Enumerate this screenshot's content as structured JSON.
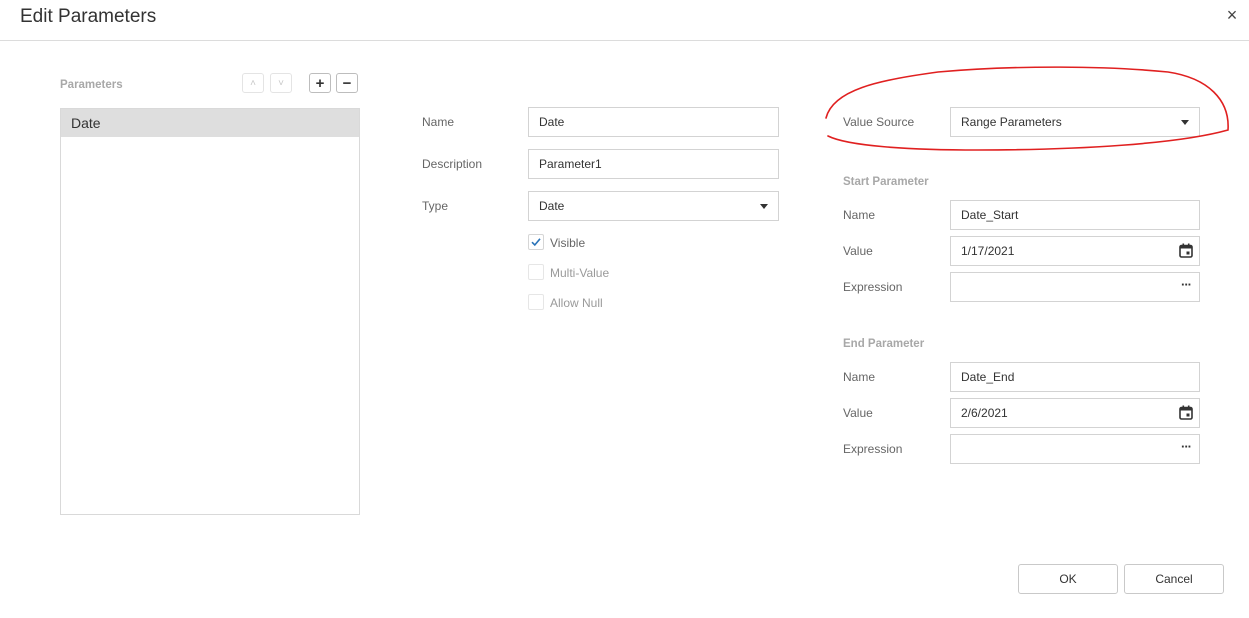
{
  "dialog": {
    "title": "Edit Parameters",
    "close_glyph": "×"
  },
  "parameters_panel": {
    "label": "Parameters",
    "move_up_glyph": "˄",
    "move_down_glyph": "˅",
    "add_glyph": "+",
    "remove_glyph": "−",
    "items": [
      {
        "label": "Date",
        "selected": true
      }
    ]
  },
  "general": {
    "name_label": "Name",
    "name_value": "Date",
    "description_label": "Description",
    "description_value": "Parameter1",
    "type_label": "Type",
    "type_value": "Date",
    "visible_label": "Visible",
    "visible_checked": true,
    "multi_value_label": "Multi-Value",
    "multi_value_checked": false,
    "allow_null_label": "Allow Null",
    "allow_null_checked": false
  },
  "value_source": {
    "label": "Value Source",
    "value": "Range Parameters",
    "annotation_color": "#e02020"
  },
  "start_parameter": {
    "section_label": "Start Parameter",
    "name_label": "Name",
    "name_value": "Date_Start",
    "value_label": "Value",
    "value_value": "1/17/2021",
    "expression_label": "Expression",
    "expression_value": "",
    "expression_button": "···"
  },
  "end_parameter": {
    "section_label": "End Parameter",
    "name_label": "Name",
    "name_value": "Date_End",
    "value_label": "Value",
    "value_value": "2/6/2021",
    "expression_label": "Expression",
    "expression_value": "",
    "expression_button": "···"
  },
  "footer": {
    "ok_label": "OK",
    "cancel_label": "Cancel"
  },
  "colors": {
    "accent": "#2a73b8",
    "selected_row": "#dedede",
    "border": "#d3d3d3"
  },
  "icons": [
    "close-icon",
    "chevron-up-icon",
    "chevron-down-icon",
    "plus-icon",
    "minus-icon",
    "dropdown-caret-icon",
    "calendar-icon",
    "ellipsis-icon",
    "checkmark-icon"
  ]
}
